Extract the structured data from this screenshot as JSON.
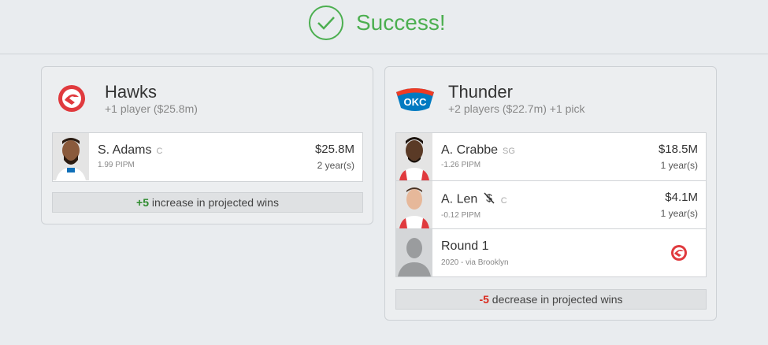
{
  "header": {
    "status_text": "Success!",
    "status_color": "#4caf50",
    "icon": "check-circle-icon"
  },
  "teams": [
    {
      "name": "Hawks",
      "summary": "+1 player ($25.8m)",
      "logo": "hawks-logo-icon",
      "players": [
        {
          "name": "S. Adams",
          "position": "C",
          "stat": "1.99 PIPM",
          "salary": "$25.8M",
          "years": "2 year(s)"
        }
      ],
      "impact": {
        "number": "+5",
        "text": " increase in projected wins"
      }
    },
    {
      "name": "Thunder",
      "summary": "+2 players ($22.7m) +1 pick",
      "logo": "okc-thunder-logo-icon",
      "players": [
        {
          "name": "A. Crabbe",
          "position": "SG",
          "stat": "-1.26 PIPM",
          "salary": "$18.5M",
          "years": "1 year(s)"
        },
        {
          "name": "A. Len",
          "position": "C",
          "stat": "-0.12 PIPM",
          "salary": "$4.1M",
          "years": "1 year(s)",
          "icon": "no-money-icon"
        }
      ],
      "picks": [
        {
          "name": "Round 1",
          "detail": "2020 - via Brooklyn",
          "logo": "hawks-logo-icon"
        }
      ],
      "impact": {
        "number": "-5",
        "text": " decrease in projected wins"
      }
    }
  ]
}
